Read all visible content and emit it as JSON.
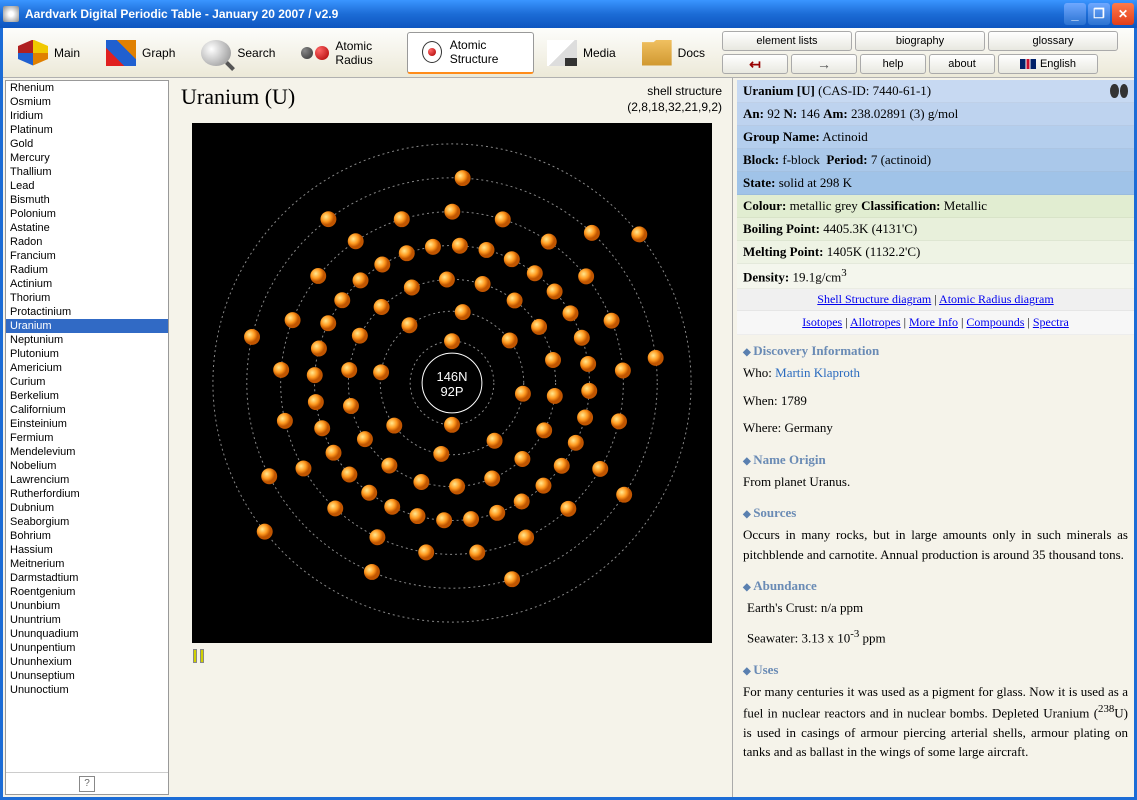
{
  "window": {
    "title": "Aardvark Digital Periodic Table - January 20 2007 / v2.9"
  },
  "toolbar": {
    "main": "Main",
    "graph": "Graph",
    "search": "Search",
    "radius": "Atomic Radius",
    "structure": "Atomic Structure",
    "media": "Media",
    "docs": "Docs"
  },
  "rightbar": {
    "lists": "element lists",
    "bio": "biography",
    "gloss": "glossary",
    "back": "↤",
    "fwd": "→",
    "help": "help",
    "about": "about",
    "lang": "English"
  },
  "elements": [
    "Rhenium",
    "Osmium",
    "Iridium",
    "Platinum",
    "Gold",
    "Mercury",
    "Thallium",
    "Lead",
    "Bismuth",
    "Polonium",
    "Astatine",
    "Radon",
    "Francium",
    "Radium",
    "Actinium",
    "Thorium",
    "Protactinium",
    "Uranium",
    "Neptunium",
    "Plutonium",
    "Americium",
    "Curium",
    "Berkelium",
    "Californium",
    "Einsteinium",
    "Fermium",
    "Mendelevium",
    "Nobelium",
    "Lawrencium",
    "Rutherfordium",
    "Dubnium",
    "Seaborgium",
    "Bohrium",
    "Hassium",
    "Meitnerium",
    "Darmstadtium",
    "Roentgenium",
    "Ununbium",
    "Ununtrium",
    "Ununquadium",
    "Ununpentium",
    "Ununhexium",
    "Ununseptium",
    "Ununoctium"
  ],
  "selected": "Uranium",
  "mid": {
    "title": "Uranium (U)",
    "shell_label": "shell structure",
    "shell_config": "(2,8,18,32,21,9,2)",
    "nucleus_n": "146N",
    "nucleus_p": "92P"
  },
  "info": {
    "header": "Uranium [U]",
    "cas": "(CAS-ID: 7440-61-1)",
    "an_lbl": "An:",
    "an": "92",
    "n_lbl": "N:",
    "n": "146",
    "am_lbl": "Am:",
    "am": "238.02891 (3) g/mol",
    "group_lbl": "Group Name:",
    "group": "Actinoid",
    "block_lbl": "Block:",
    "block": "f-block",
    "period_lbl": "Period:",
    "period": "7 (actinoid)",
    "state_lbl": "State:",
    "state": "solid at 298 K",
    "colour_lbl": "Colour:",
    "colour": "metallic grey",
    "class_lbl": "Classification:",
    "class": "Metallic",
    "bp_lbl": "Boiling Point:",
    "bp": "4405.3K (4131'C)",
    "mp_lbl": "Melting Point:",
    "mp": "1405K (1132.2'C)",
    "dens_lbl": "Density:",
    "dens": "19.1g/cm",
    "dens_sup": "3",
    "link_shell": "Shell Structure diagram",
    "link_radius": "Atomic Radius diagram",
    "link_iso": "Isotopes",
    "link_allo": "Allotropes",
    "link_more": "More Info",
    "link_comp": "Compounds",
    "link_spec": "Spectra",
    "disc_h": "Discovery Information",
    "disc_who_lbl": "Who:",
    "disc_who": "Martin Klaproth",
    "disc_when_lbl": "When:",
    "disc_when": "1789",
    "disc_where_lbl": "Where:",
    "disc_where": "Germany",
    "orig_h": "Name Origin",
    "orig": "From planet Uranus.",
    "src_h": "Sources",
    "src": "Occurs in many rocks, but in large amounts only in such minerals as pitchblende and carnotite. Annual production is around 35 thousand tons.",
    "abund_h": "Abundance",
    "abund_crust": "Earth's Crust: n/a ppm",
    "abund_sea_pre": "Seawater: 3.13 x 10",
    "abund_sea_sup": "-3",
    "abund_sea_post": " ppm",
    "uses_h": "Uses",
    "uses_pre": "For many centuries it was used as a pigment for glass. Now it is used as a fuel in nuclear reactors and in nuclear bombs. Depleted Uranium (",
    "uses_sup": "238",
    "uses_post": "U) is used in casings of armour piercing arterial shells, armour plating on tanks and as ballast in the wings of some large aircraft."
  },
  "shells": [
    2,
    8,
    18,
    32,
    21,
    9,
    2
  ]
}
